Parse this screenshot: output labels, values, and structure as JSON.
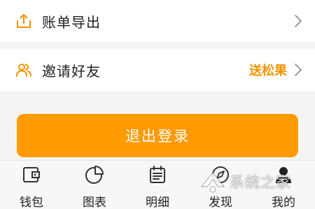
{
  "menu": {
    "export": {
      "label": "账单导出",
      "icon": "upload-icon"
    },
    "invite": {
      "label": "邀请好友",
      "icon": "people-icon",
      "reward": "送松果"
    }
  },
  "logout": {
    "label": "退出登录"
  },
  "tabbar": {
    "tabs": [
      {
        "label": "钱包",
        "icon": "wallet-icon"
      },
      {
        "label": "图表",
        "icon": "pie-chart-icon"
      },
      {
        "label": "明细",
        "icon": "calendar-icon"
      },
      {
        "label": "发现",
        "icon": "discover-icon"
      },
      {
        "label": "我的",
        "icon": "profile-icon"
      }
    ]
  },
  "watermark": {
    "text": "系统之家"
  },
  "colors": {
    "accent": "#ff9a00",
    "accent_text": "#f29300",
    "background": "#f4f4f4",
    "card": "#ffffff"
  }
}
